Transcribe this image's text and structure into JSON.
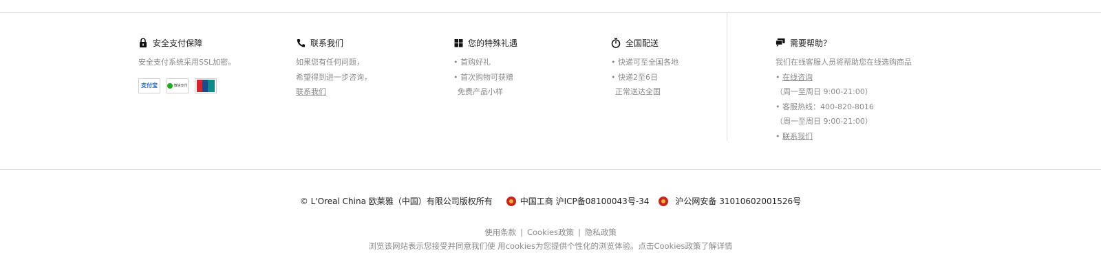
{
  "columns": [
    {
      "title": "安全支付保障",
      "icon": "lock-icon",
      "lines": [
        "安全支付系统采用SSL加密。"
      ],
      "payment_logos": [
        "支付宝",
        "微信支付",
        "UnionPay 银联"
      ]
    },
    {
      "title": "联系我们",
      "icon": "phone-icon",
      "lines": [
        "如果您有任何问题，",
        "希望得到进一步咨询，"
      ],
      "link": "联系我们"
    },
    {
      "title": "您的特殊礼遇",
      "icon": "gift-icon",
      "lines": [
        "• 首购好礼",
        "• 首次购物可获赠",
        "免费产品小样"
      ]
    },
    {
      "title": "全国配送",
      "icon": "stopwatch-icon",
      "lines": [
        "• 快递可至全国各地",
        "• 快递2至6日",
        "正常送达全国"
      ]
    },
    {
      "title": "需要帮助？",
      "icon": "chat-icon",
      "intro": "我们在线客服人员将帮助您在线选购商品",
      "online_link": "在线咨询",
      "hours1": "（周一至周日 9:00-21:00）",
      "hotline": "• 客服热线：400-820-8016",
      "hours2": "（周一至周日 9:00-21:00）",
      "contact_link": "联系我们"
    }
  ],
  "copyright": {
    "company": "© L'Oreal China 欧莱雅（中国）有限公司版权所有",
    "icp": "中国工商 沪ICP备08100043号-34",
    "police": "沪公网安备 31010602001526号"
  },
  "legal_links": [
    "使用条款",
    "Cookies政策",
    "隐私政策"
  ],
  "separator": "|",
  "cookie_note": "浏览该网站表示您接受并同意我们使 用cookies为您提供个性化的浏览体验。点击Cookies政策了解详情",
  "colors": {
    "text_dark": "#222222",
    "text_muted": "#8a8a8a",
    "rule": "#dcdcdc"
  }
}
